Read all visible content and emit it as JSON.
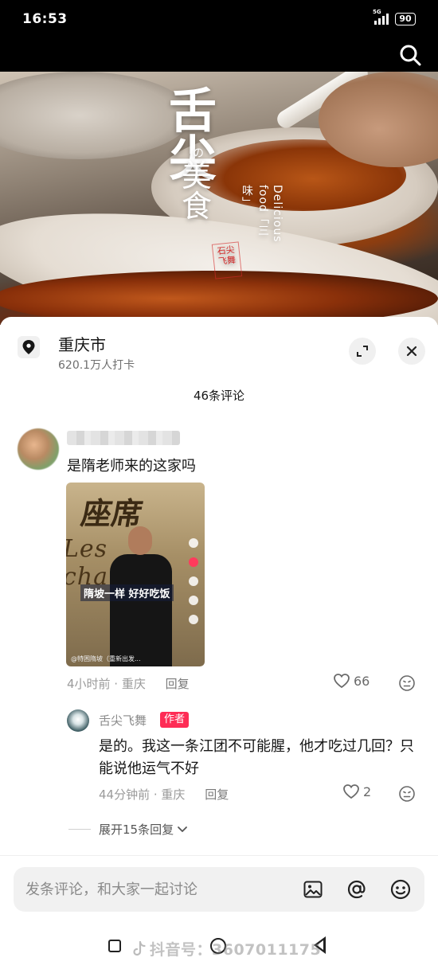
{
  "status_bar": {
    "time": "16:53",
    "network": "5G",
    "battery": "90"
  },
  "hero": {
    "title_big": "舌尖",
    "title_de": "の",
    "title_mid": "美食",
    "title_vertical": "Delicious food「三味」",
    "seal": "石尖飞舞"
  },
  "location": {
    "name": "重庆市",
    "checkins": "620.1万人打卡"
  },
  "comments": {
    "count_label": "46条评论",
    "items": [
      {
        "text": "是隋老师来的这家吗",
        "thumb_caption": "隋坡一样 好好吃饭",
        "thumb_footer": "@特困隋坡（重新出发...",
        "time_location": "4小时前 · 重庆",
        "reply_label": "回复",
        "likes": "66"
      }
    ],
    "reply": {
      "name": "舌尖飞舞",
      "badge": "作者",
      "text": "是的。我这一条江团不可能腥，他才吃过几回？只能说他运气不好",
      "time_location": "44分钟前 · 重庆",
      "reply_label": "回复",
      "likes": "2"
    },
    "expand_label": "展开15条回复"
  },
  "input": {
    "placeholder": "发条评论，和大家一起讨论"
  },
  "watermark": "抖音号：3607011175",
  "colors": {
    "accent": "#fe2c55",
    "sheet_bg": "#ffffff",
    "hero_dark": "#000000"
  }
}
